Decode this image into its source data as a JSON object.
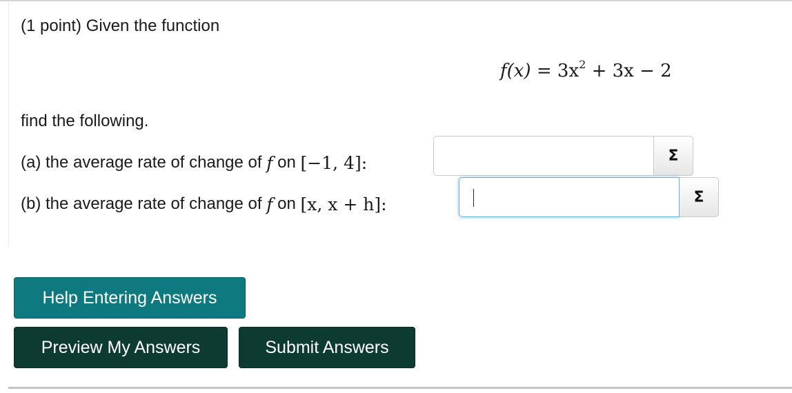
{
  "problem": {
    "intro": "(1 point) Given the function",
    "equation": {
      "lhs": "f(x)",
      "equals": "=",
      "term1_coef": "3x",
      "term1_exp": "2",
      "rest": "+ 3x − 2"
    },
    "find": "find the following.",
    "part_a": {
      "prefix": "(a) the average rate of change of",
      "func": "f",
      "on": "on",
      "interval": "[−1, 4]:",
      "answer_value": ""
    },
    "part_b": {
      "prefix": "(b) the average rate of change of",
      "func": "f",
      "on": "on",
      "interval": "[x, x + h]:",
      "answer_value": ""
    },
    "equation_editor_symbol": "Σ"
  },
  "buttons": {
    "help": "Help Entering Answers",
    "preview": "Preview My Answers",
    "submit": "Submit Answers"
  },
  "colors": {
    "help_button": "#0e7a7f",
    "action_buttons": "#0e3b30",
    "focus_ring": "#66afe9"
  }
}
